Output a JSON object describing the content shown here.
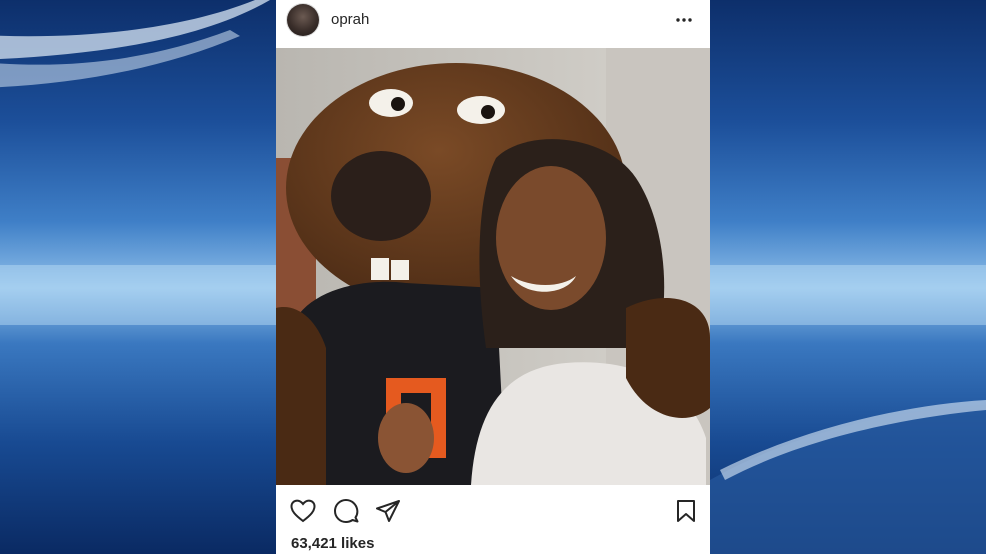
{
  "post": {
    "username": "oprah",
    "likes_text": "63,421 likes"
  },
  "icons": {
    "more": "more-options-icon",
    "like": "heart-icon",
    "comment": "comment-icon",
    "share": "share-icon",
    "save": "bookmark-icon"
  },
  "colors": {
    "text": "#262626",
    "card": "#ffffff",
    "background_blue": "#1c4f9a"
  }
}
